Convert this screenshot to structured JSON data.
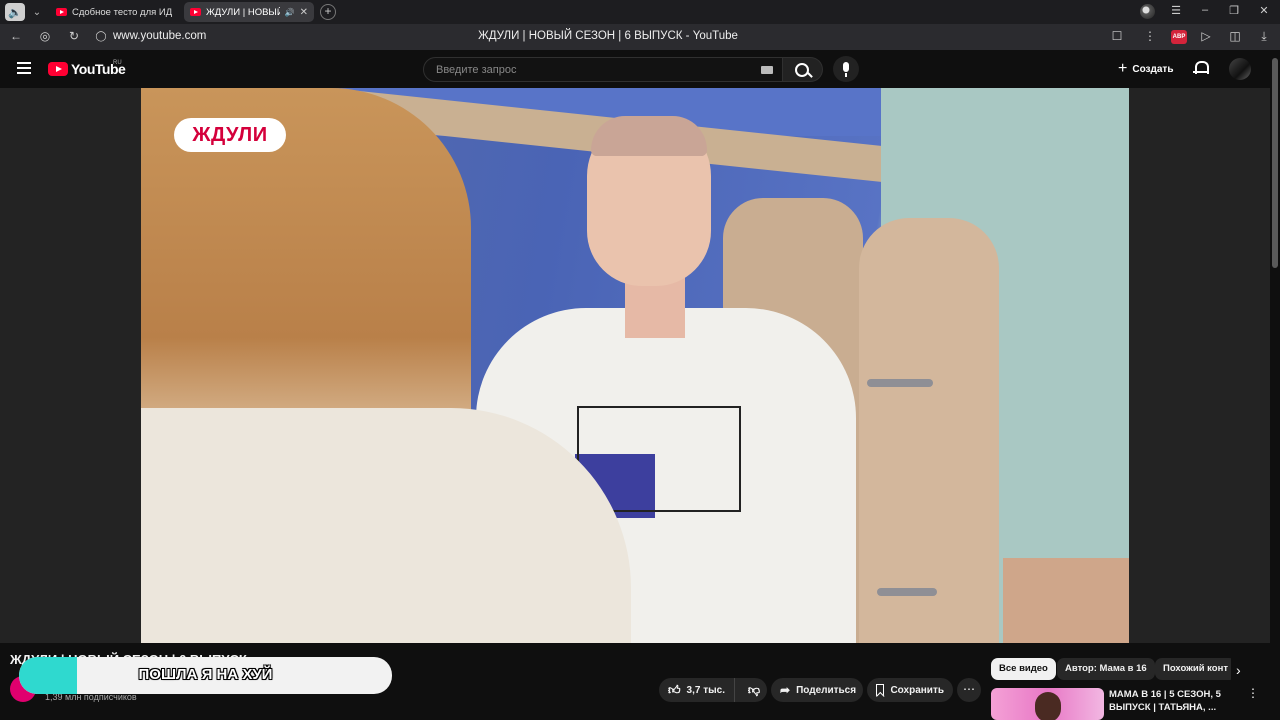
{
  "browser": {
    "tabs": [
      {
        "title": "Сдобное тесто для ИДЕАЛ",
        "active": false
      },
      {
        "title": "ЖДУЛИ | НОВЫЙ СЕЗ",
        "active": true
      }
    ],
    "url": "www.youtube.com",
    "page_title": "ЖДУЛИ | НОВЫЙ СЕЗОН | 6 ВЫПУСК - YouTube",
    "adblock_label": "ABP"
  },
  "header": {
    "logo_text": "YouTube",
    "country_code": "RU",
    "search_placeholder": "Введите запрос",
    "create_label": "Создать"
  },
  "video": {
    "show_logo": "ЖДУЛИ",
    "title": "ЖДУЛИ | НОВЫЙ СЕЗОН | 6 ВЫПУСК"
  },
  "overlay": {
    "text": "ПОШЛА Я НА ХУЙ"
  },
  "channel": {
    "subscribers": "1,39 млн подписчиков"
  },
  "actions": {
    "likes": "3,7 тыс.",
    "share_label": "Поделиться",
    "save_label": "Сохранить"
  },
  "chips": [
    "Все видео",
    "Автор: Мама в 16",
    "Похожий конт"
  ],
  "recommendation": {
    "title": "МАМА В 16 | 5 СЕЗОН, 5 ВЫПУСК | ТАТЬЯНА, ..."
  }
}
